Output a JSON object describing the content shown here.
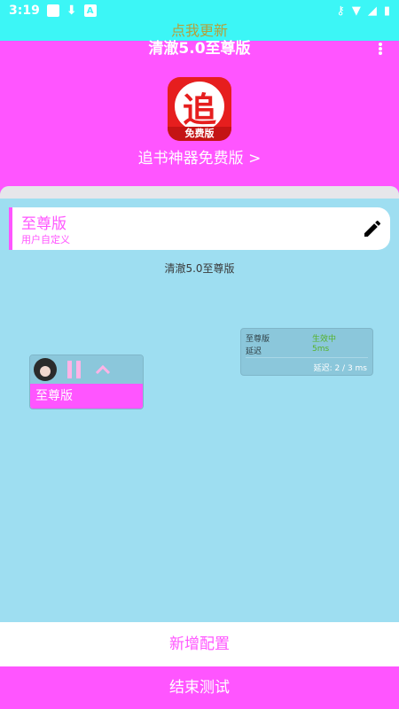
{
  "status_bar": {
    "time": "3:19"
  },
  "banner": {
    "update_text": "点我更新"
  },
  "header": {
    "title": "清澈5.0至尊版"
  },
  "app": {
    "icon_char": "追",
    "icon_badge": "免费版",
    "link_text": "追书神器免费版 >"
  },
  "config": {
    "name": "至尊版",
    "type": "用户自定义"
  },
  "status_text": "清澈5.0至尊版",
  "stats": {
    "row1_label": "至尊版",
    "row1_value": "生效中",
    "row2_label": "延迟",
    "row2_value": "5ms",
    "footer": "延迟: 2 / 3 ms"
  },
  "player": {
    "label": "至尊版"
  },
  "buttons": {
    "add_config": "新增配置",
    "end_test": "结束测试"
  },
  "colors": {
    "accent": "#FF55FF",
    "status_bar": "#3CF6F6",
    "panel_bg": "#9EDEF1"
  }
}
